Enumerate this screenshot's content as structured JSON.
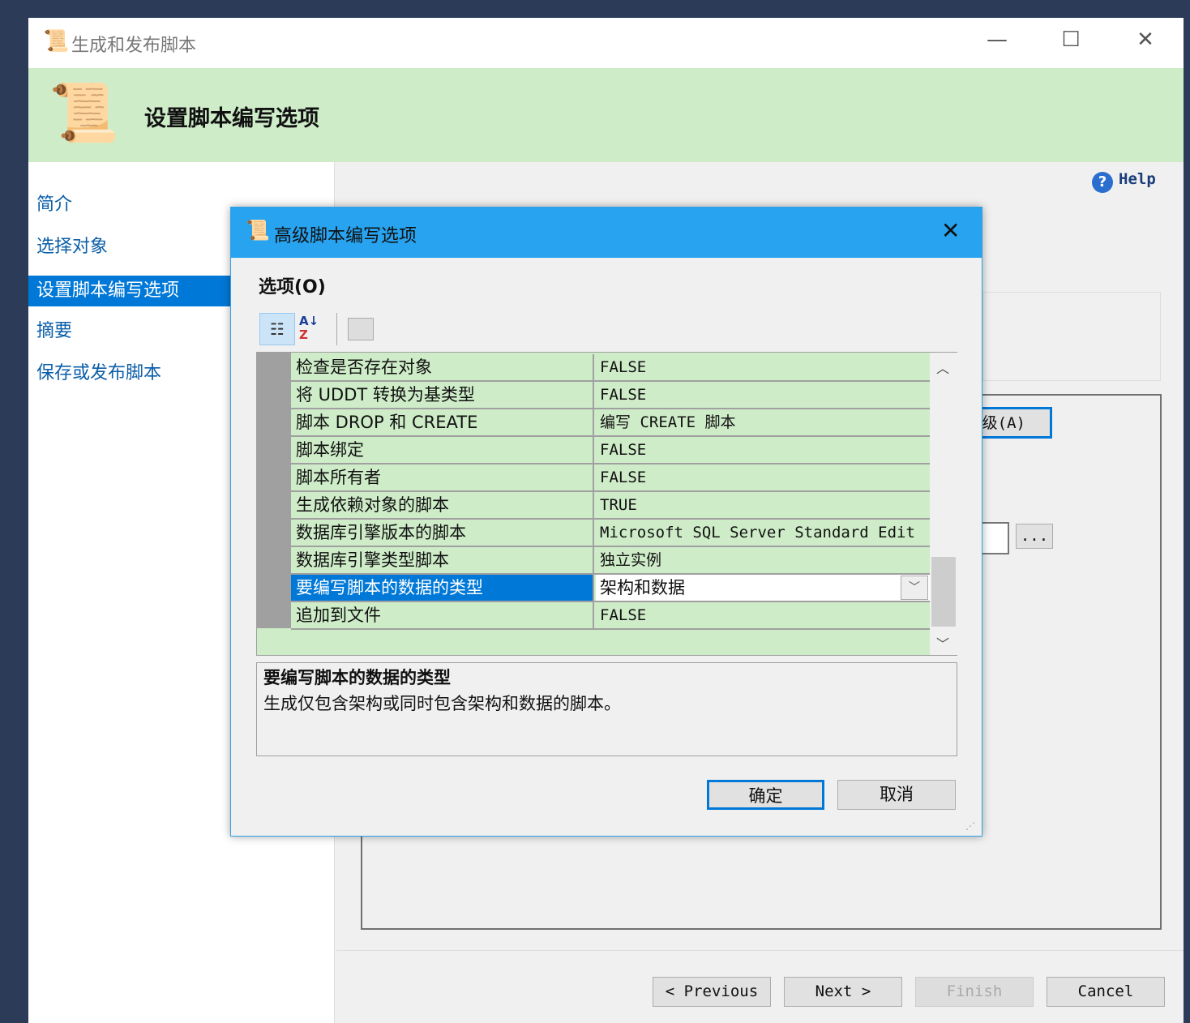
{
  "window": {
    "title": "生成和发布脚本",
    "minimize": "—",
    "maximize": "☐",
    "close": "✕"
  },
  "header": {
    "title": "设置脚本编写选项"
  },
  "nav": {
    "items": [
      {
        "label": "简介"
      },
      {
        "label": "选择对象"
      },
      {
        "label": "设置脚本编写选项",
        "selected": true
      },
      {
        "label": "摘要"
      },
      {
        "label": "保存或发布脚本"
      }
    ]
  },
  "main": {
    "help": "Help",
    "advanced_button": "级(A)",
    "browse_button": "..."
  },
  "footer": {
    "previous": "< Previous",
    "next": "Next >",
    "finish": "Finish",
    "cancel": "Cancel"
  },
  "dialog": {
    "title": "高级脚本编写选项",
    "close": "✕",
    "section": "选项(O)",
    "rows": [
      {
        "name": "检查是否存在对象",
        "value": "FALSE"
      },
      {
        "name": "将 UDDT 转换为基类型",
        "value": "FALSE"
      },
      {
        "name": "脚本 DROP 和 CREATE",
        "value": "编写 CREATE 脚本"
      },
      {
        "name": "脚本绑定",
        "value": "FALSE"
      },
      {
        "name": "脚本所有者",
        "value": "FALSE"
      },
      {
        "name": "生成依赖对象的脚本",
        "value": "TRUE"
      },
      {
        "name": "数据库引擎版本的脚本",
        "value": "Microsoft SQL Server Standard Edit"
      },
      {
        "name": "数据库引擎类型脚本",
        "value": "独立实例"
      },
      {
        "name": "要编写脚本的数据的类型",
        "value": "架构和数据",
        "selected": true
      },
      {
        "name": "追加到文件",
        "value": "FALSE"
      }
    ],
    "description": {
      "title": "要编写脚本的数据的类型",
      "text": "生成仅包含架构或同时包含架构和数据的脚本。"
    },
    "ok": "确定",
    "cancel": "取消"
  },
  "colors": {
    "header_green": "#ceecc8",
    "accent": "#0078d7",
    "dialog_titlebar": "#27a3ef"
  }
}
